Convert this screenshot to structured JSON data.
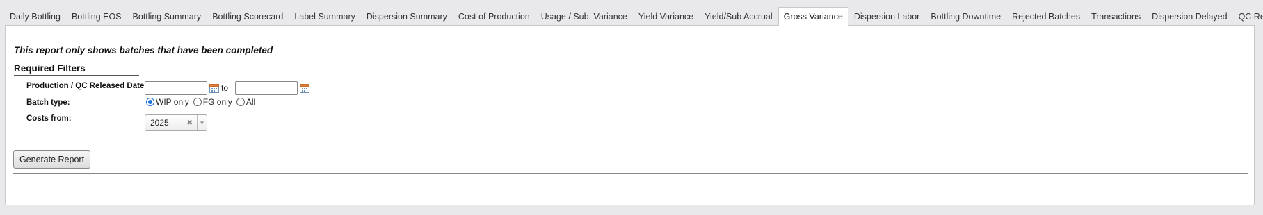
{
  "tabs": [
    {
      "label": "Daily Bottling"
    },
    {
      "label": "Bottling EOS"
    },
    {
      "label": "Bottling Summary"
    },
    {
      "label": "Bottling Scorecard"
    },
    {
      "label": "Label Summary"
    },
    {
      "label": "Dispersion Summary"
    },
    {
      "label": "Cost of Production"
    },
    {
      "label": "Usage / Sub. Variance"
    },
    {
      "label": "Yield Variance"
    },
    {
      "label": "Yield/Sub Accrual"
    },
    {
      "label": "Gross Variance",
      "active": true
    },
    {
      "label": "Dispersion Labor"
    },
    {
      "label": "Bottling Downtime"
    },
    {
      "label": "Rejected Batches"
    },
    {
      "label": "Transactions"
    },
    {
      "label": "Dispersion Delayed"
    },
    {
      "label": "QC Report"
    }
  ],
  "notice": "This report only shows batches that have been completed",
  "filters": {
    "title": "Required Filters",
    "date_label": "Production / QC Released Date",
    "date_from": "",
    "to_text": "to",
    "date_to": "",
    "batch_type_label": "Batch type:",
    "batch_options": [
      "WIP only",
      "FG only",
      "All"
    ],
    "batch_selected": "WIP only",
    "costs_label": "Costs from:",
    "costs_value": "2025"
  },
  "actions": {
    "generate_label": "Generate Report"
  },
  "colors": {
    "accent": "#1a6fd8",
    "background": "#e9e9eb",
    "panel": "#ffffff"
  },
  "icons": {
    "calendar": "calendar-icon",
    "clear": "clear-icon",
    "dropdown": "chevron-down-icon"
  }
}
